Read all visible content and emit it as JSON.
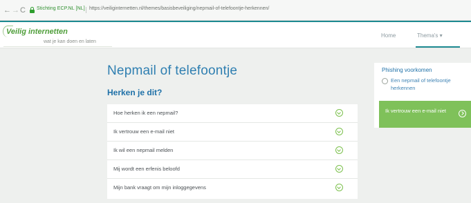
{
  "browser": {
    "back_label": "←",
    "forward_label": "→",
    "reload_label": "C",
    "site_identity": "Stichting ECP.NL [NL]",
    "url": "https://veiliginternetten.nl/themes/basisbeveiliging/nepmail-of-telefoontje-herkennen/"
  },
  "header": {
    "logo_title": "Veilig internetten",
    "logo_tagline": "wat je kan doen en laten",
    "nav": {
      "home": "Home",
      "themas": "Thema's ▾"
    }
  },
  "main": {
    "title": "Nepmail of telefoontje",
    "section_heading": "Herken je dit?",
    "items": [
      {
        "label": "Hoe herken ik een nepmail?"
      },
      {
        "label": "Ik vertrouw een e-mail niet"
      },
      {
        "label": "Ik wil een nepmail melden"
      },
      {
        "label": "Mij wordt een erfenis beloofd"
      },
      {
        "label": "Mijn bank vraagt om mijn inloggegevens"
      }
    ]
  },
  "sidebar": {
    "heading": "Phishing voorkomen",
    "link": "Een nepmail of telefoontje herkennen",
    "cta": "Ik vertrouw een e-mail niet"
  },
  "colors": {
    "accent_teal": "#1d8a91",
    "brand_green": "#4f9e3a",
    "title_blue": "#2f7fb1",
    "cta_green": "#7fc15a"
  }
}
